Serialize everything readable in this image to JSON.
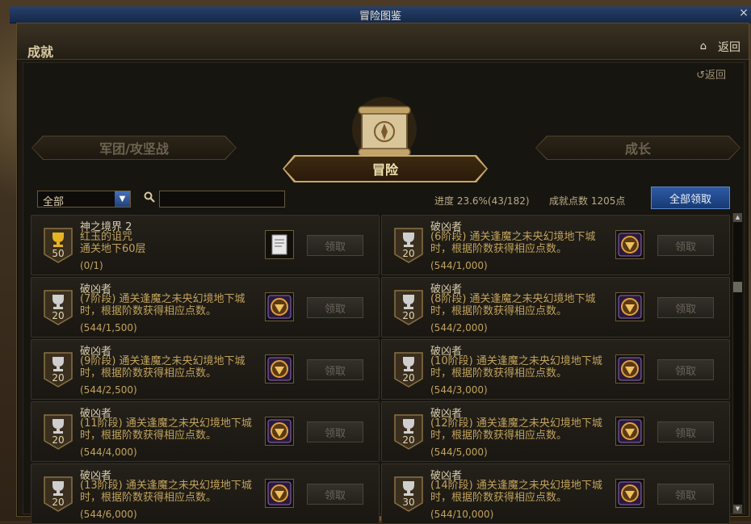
{
  "window": {
    "title": "冒险图鉴",
    "close": "×"
  },
  "header": {
    "title": "成就",
    "home_icon": "⌂",
    "back": "返回"
  },
  "inner_back": "↺返回",
  "tabs": [
    {
      "label": "军团/攻坚战",
      "active": false
    },
    {
      "label": "冒险",
      "active": true
    },
    {
      "label": "成长",
      "active": false
    }
  ],
  "filter": {
    "selected": "全部",
    "arrow": "▼",
    "search_icon": "🔍",
    "search_value": ""
  },
  "progress_text": "进度 23.6%(43/182)",
  "points_text": "成就点数 1205点",
  "claim_all": "全部领取",
  "claim_label": "领取",
  "cards": [
    {
      "title": "神之境界 2",
      "line1": "红玉的诅咒",
      "line2": "通关地下60层",
      "progress": "(0/1)",
      "badge": "50",
      "badge_tier": "gold",
      "reward": "scroll"
    },
    {
      "title": "破凶者",
      "line1": "(6阶段) 通关逢魔之未央幻境地下城时，根据阶数获得相应点数。",
      "line2": "",
      "progress": "(544/1,000)",
      "badge": "20",
      "badge_tier": "silver",
      "reward": "emblem"
    },
    {
      "title": "破凶者",
      "line1": "(7阶段) 通关逢魔之未央幻境地下城时，根据阶数获得相应点数。",
      "line2": "",
      "progress": "(544/1,500)",
      "badge": "20",
      "badge_tier": "silver",
      "reward": "emblem"
    },
    {
      "title": "破凶者",
      "line1": "(8阶段) 通关逢魔之未央幻境地下城时，根据阶数获得相应点数。",
      "line2": "",
      "progress": "(544/2,000)",
      "badge": "20",
      "badge_tier": "silver",
      "reward": "emblem"
    },
    {
      "title": "破凶者",
      "line1": "(9阶段) 通关逢魔之未央幻境地下城时，根据阶数获得相应点数。",
      "line2": "",
      "progress": "(544/2,500)",
      "badge": "20",
      "badge_tier": "silver",
      "reward": "emblem"
    },
    {
      "title": "破凶者",
      "line1": "(10阶段) 通关逢魔之未央幻境地下城时，根据阶数获得相应点数。",
      "line2": "",
      "progress": "(544/3,000)",
      "badge": "20",
      "badge_tier": "silver",
      "reward": "emblem"
    },
    {
      "title": "破凶者",
      "line1": "(11阶段) 通关逢魔之未央幻境地下城时，根据阶数获得相应点数。",
      "line2": "",
      "progress": "(544/4,000)",
      "badge": "20",
      "badge_tier": "silver",
      "reward": "emblem"
    },
    {
      "title": "破凶者",
      "line1": "(12阶段) 通关逢魔之未央幻境地下城时，根据阶数获得相应点数。",
      "line2": "",
      "progress": "(544/5,000)",
      "badge": "20",
      "badge_tier": "silver",
      "reward": "emblem"
    },
    {
      "title": "破凶者",
      "line1": "(13阶段) 通关逢魔之未央幻境地下城时，根据阶数获得相应点数。",
      "line2": "",
      "progress": "(544/6,000)",
      "badge": "20",
      "badge_tier": "silver",
      "reward": "emblem"
    },
    {
      "title": "破凶者",
      "line1": "(14阶段) 通关逢魔之未央幻境地下城时，根据阶数获得相应点数。",
      "line2": "",
      "progress": "(544/10,000)",
      "badge": "30",
      "badge_tier": "silver",
      "reward": "emblem"
    }
  ],
  "colors": {
    "accent_blue": "#2d5aa5",
    "gold_text": "#c1a35c",
    "gold_trophy": "#e6b422",
    "silver_trophy": "#cfcfcf"
  }
}
